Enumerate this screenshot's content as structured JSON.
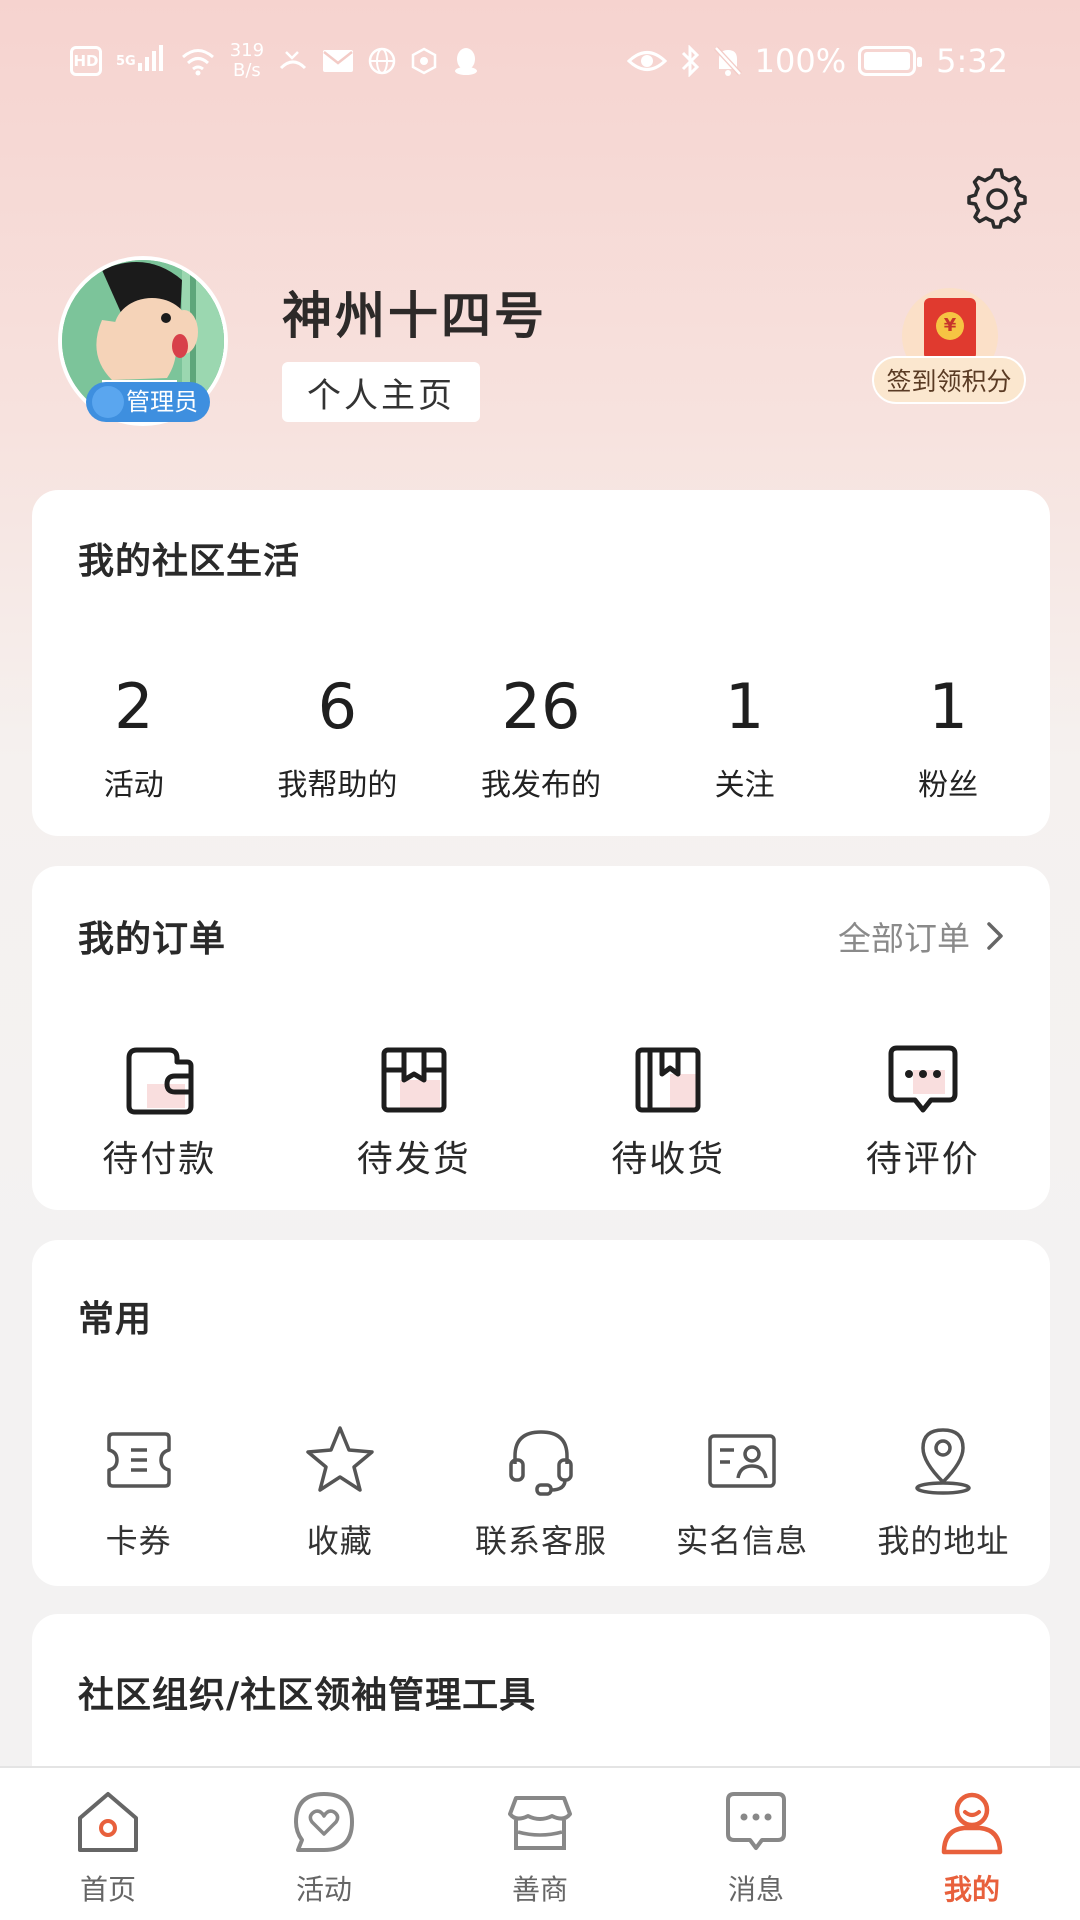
{
  "status_bar": {
    "hd": "HD",
    "signal": "5G",
    "speed_value": "319",
    "speed_unit": "B/s",
    "battery": "100%",
    "time": "5:32"
  },
  "header": {
    "username": "神州十四号",
    "admin_badge": "管理员",
    "homepage_button": "个人主页",
    "checkin_label": "签到领积分",
    "redpacket_symbol": "¥",
    "settings_icon": "gear-icon"
  },
  "community": {
    "title": "我的社区生活",
    "stats": [
      {
        "value": "2",
        "label": "活动"
      },
      {
        "value": "6",
        "label": "我帮助的"
      },
      {
        "value": "26",
        "label": "我发布的"
      },
      {
        "value": "1",
        "label": "关注"
      },
      {
        "value": "1",
        "label": "粉丝"
      }
    ]
  },
  "orders": {
    "title": "我的订单",
    "all_orders": "全部订单",
    "items": [
      {
        "label": "待付款",
        "icon": "wallet-icon"
      },
      {
        "label": "待发货",
        "icon": "package-icon"
      },
      {
        "label": "待收货",
        "icon": "book-icon"
      },
      {
        "label": "待评价",
        "icon": "chat-bubble-icon"
      }
    ]
  },
  "common": {
    "title": "常用",
    "items": [
      {
        "label": "卡券",
        "icon": "ticket-icon"
      },
      {
        "label": "收藏",
        "icon": "star-icon"
      },
      {
        "label": "联系客服",
        "icon": "headset-icon"
      },
      {
        "label": "实名信息",
        "icon": "id-card-icon"
      },
      {
        "label": "我的地址",
        "icon": "location-pin-icon"
      }
    ]
  },
  "tools": {
    "title": "社区组织/社区领袖管理工具"
  },
  "bottom_nav": {
    "items": [
      {
        "label": "首页",
        "icon": "home-icon"
      },
      {
        "label": "活动",
        "icon": "heart-bubble-icon"
      },
      {
        "label": "善商",
        "icon": "shop-icon"
      },
      {
        "label": "消息",
        "icon": "message-icon"
      },
      {
        "label": "我的",
        "icon": "person-icon",
        "active": true
      }
    ]
  },
  "colors": {
    "accent": "#e8603c",
    "header_gradient_top": "#f6d3cf",
    "admin_badge": "#3e8fdf",
    "redpacket": "#e03a2f"
  }
}
